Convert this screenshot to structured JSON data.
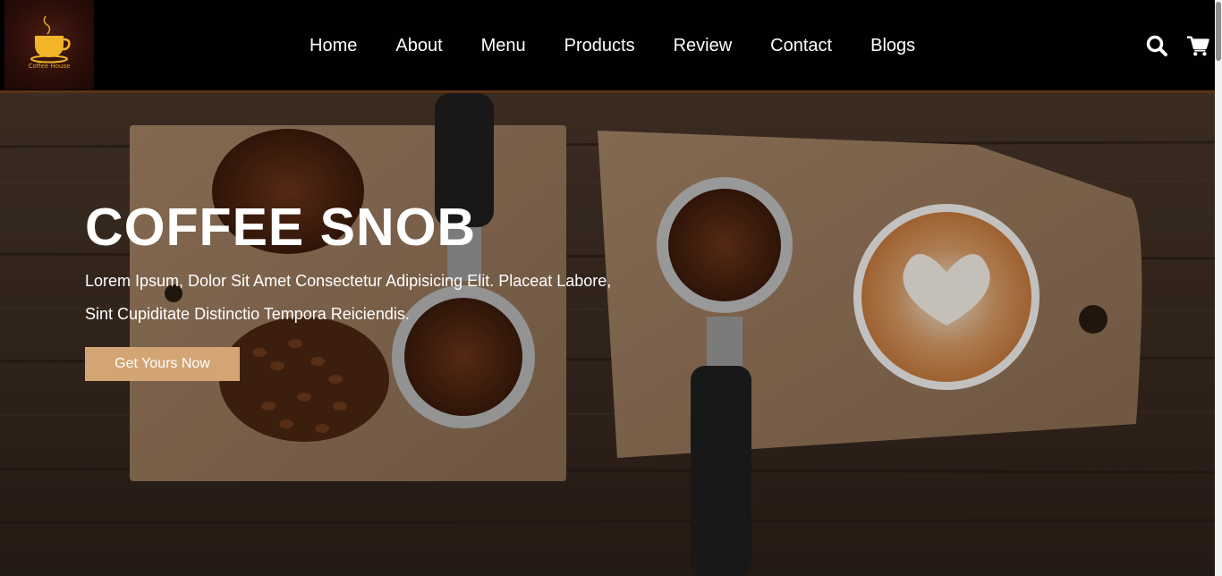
{
  "header": {
    "logo_text": "Coffee House",
    "nav": [
      "Home",
      "About",
      "Menu",
      "Products",
      "Review",
      "Contact",
      "Blogs"
    ],
    "icons": [
      "search-icon",
      "cart-icon"
    ]
  },
  "hero": {
    "title": "COFFEE SNOB",
    "text": "Lorem Ipsum, Dolor Sit Amet Consectetur Adipisicing Elit. Placeat Labore, Sint Cupiditate Distinctio Tempora Reiciendis.",
    "button_label": "Get Yours Now"
  },
  "colors": {
    "header_bg": "#010103",
    "accent": "#d3a474",
    "border": "#5a3315",
    "logo_cup": "#e3a52a"
  }
}
